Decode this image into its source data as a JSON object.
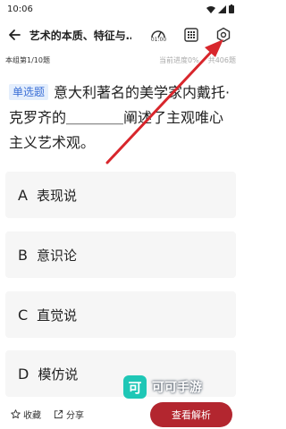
{
  "status": {
    "time": "10:06"
  },
  "header": {
    "title": "艺术的本质、特征与…",
    "timer": "01:00"
  },
  "subbar": {
    "group": "本组第1/10题",
    "progress": "当前进度0%",
    "total": "共406题"
  },
  "question": {
    "type": "单选题",
    "text": "意大利著名的美学家内戴托·克罗齐的＿＿＿＿阐述了主观唯心主义艺术观。"
  },
  "options": [
    {
      "letter": "A",
      "text": "表现说"
    },
    {
      "letter": "B",
      "text": "意识论"
    },
    {
      "letter": "C",
      "text": "直觉说"
    },
    {
      "letter": "D",
      "text": "模仿说"
    }
  ],
  "bottom": {
    "favorite": "收藏",
    "share": "分享",
    "view_answer": "查看解析"
  },
  "watermark": {
    "logo_char": "可",
    "text": "可可手游"
  },
  "colors": {
    "accent": "#b3262f",
    "arrow": "#d8262c",
    "tag_bg": "#e4eefc",
    "tag_text": "#3b6fd6"
  }
}
